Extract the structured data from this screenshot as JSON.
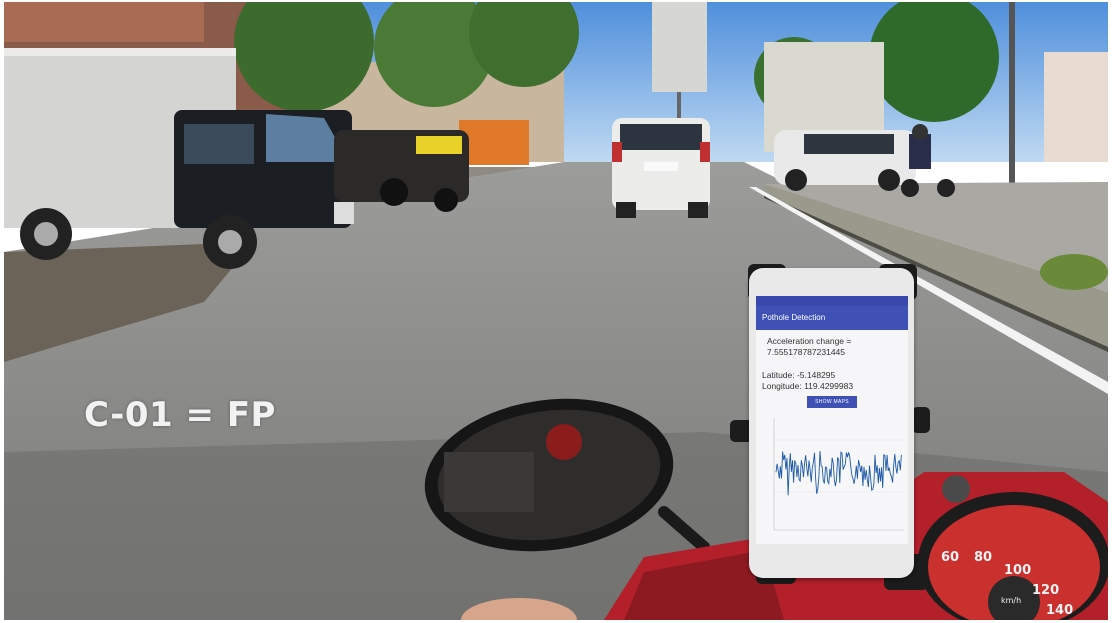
{
  "overlay": {
    "label": "C-01 = FP"
  },
  "phone": {
    "app_title": "Pothole Detection",
    "acceleration_label": "Acceleration change =",
    "acceleration_value": "7.555178787231445",
    "latitude": "Latitude: -5.148295",
    "longitude": "Longitude: 119.4299983",
    "show_maps_label": "SHOW MAPS"
  },
  "colors": {
    "app_bar": "#3f51b5",
    "signal_line": "#1e5aa8",
    "motorbike_body": "#b3202a"
  },
  "icons": {
    "rear_mirror": "rear-mirror-icon",
    "speedometer": "speedometer-icon",
    "phone_holder": "phone-holder-icon"
  }
}
